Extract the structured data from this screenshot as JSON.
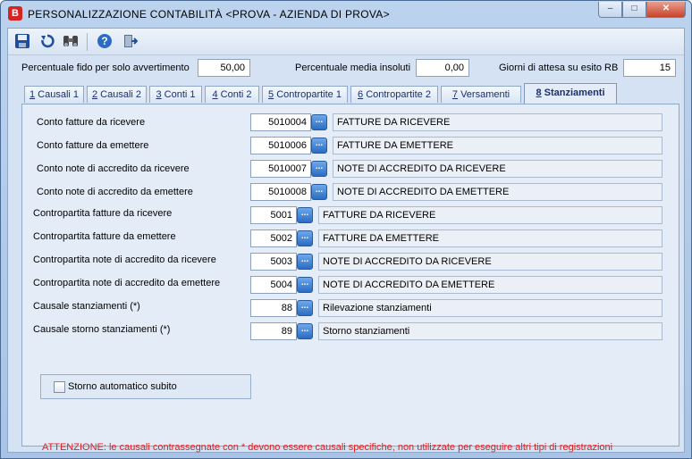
{
  "window": {
    "title": "PERSONALIZZAZIONE CONTABILITÀ <PROVA - AZIENDA DI PROVA>",
    "app_icon": "B",
    "minimize": "–",
    "maximize": "□",
    "close": "✕"
  },
  "toolbar": {
    "icons": [
      "save-icon",
      "refresh-icon",
      "binoculars-icon",
      "help-icon",
      "exit-icon"
    ]
  },
  "header": {
    "fido_label": "Percentuale fido per solo avvertimento",
    "fido_value": "50,00",
    "insoluti_label": "Percentuale media insoluti",
    "insoluti_value": "0,00",
    "giorni_label": "Giorni di attesa su esito RB",
    "giorni_value": "15"
  },
  "tabs": [
    {
      "num": "1",
      "label": " Causali 1"
    },
    {
      "num": "2",
      "label": " Causali 2"
    },
    {
      "num": "3",
      "label": " Conti 1"
    },
    {
      "num": "4",
      "label": " Conti 2"
    },
    {
      "num": "5",
      "label": " Contropartite 1"
    },
    {
      "num": "6",
      "label": " Contropartite 2"
    },
    {
      "num": "7",
      "label": " Versamenti"
    },
    {
      "num": "8",
      "label": " Stanziamenti"
    }
  ],
  "rows": [
    {
      "label": "Conto fatture da ricevere",
      "code": "5010004",
      "desc": "FATTURE DA RICEVERE"
    },
    {
      "label": "Conto fatture da emettere",
      "code": "5010006",
      "desc": "FATTURE DA EMETTERE"
    },
    {
      "label": "Conto note di accredito da ricevere",
      "code": "5010007",
      "desc": "NOTE DI ACCREDITO DA RICEVERE"
    },
    {
      "label": "Conto note di accredito da emettere",
      "code": "5010008",
      "desc": "NOTE DI ACCREDITO DA EMETTERE"
    },
    {
      "label": "Contropartita fatture da ricevere",
      "code": "5001",
      "desc": "FATTURE DA RICEVERE"
    },
    {
      "label": "Contropartita fatture da emettere",
      "code": "5002",
      "desc": "FATTURE DA EMETTERE"
    },
    {
      "label": "Contropartita note di accredito da ricevere",
      "code": "5003",
      "desc": "NOTE DI ACCREDITO DA RICEVERE"
    },
    {
      "label": "Contropartita note di accredito da emettere",
      "code": "5004",
      "desc": "NOTE DI ACCREDITO DA EMETTERE"
    },
    {
      "label": "Causale stanziamenti (*)",
      "code": "88",
      "desc": "Rilevazione stanziamenti"
    },
    {
      "label": "Causale storno stanziamenti (*)",
      "code": "89",
      "desc": "Storno stanziamenti"
    }
  ],
  "lookup_glyph": "...",
  "storno": {
    "label": "Storno automatico subito",
    "checked": false
  },
  "warning": "ATTENZIONE: le causali contrassegnate con * devono essere causali specifiche, non utilizzate per eseguire altri tipi di registrazioni",
  "colors": {
    "warning": "#e02020",
    "accent": "#2a6cc4"
  }
}
